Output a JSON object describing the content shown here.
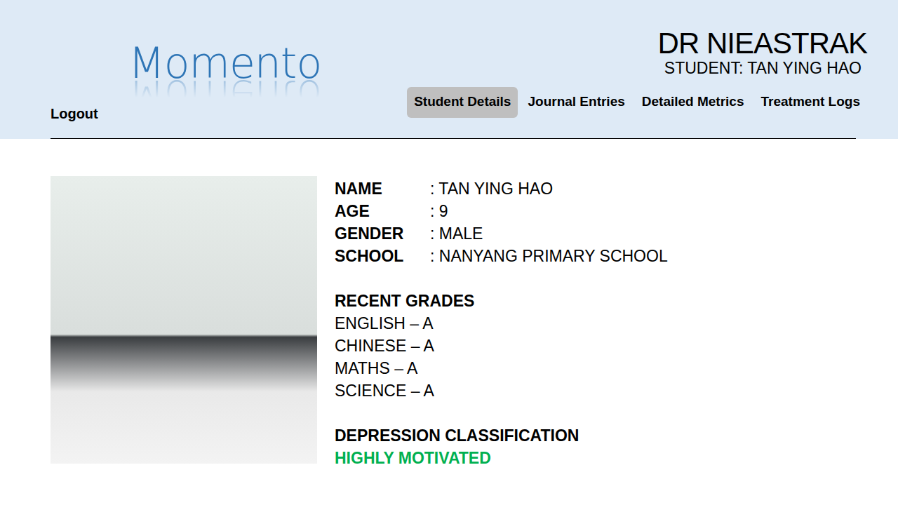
{
  "app": {
    "logo": "Momento",
    "logout": "Logout"
  },
  "header": {
    "doctor": "DR NIEASTRAK",
    "student": "STUDENT: TAN YING HAO"
  },
  "tabs": [
    {
      "label": "Student Details",
      "selected": true
    },
    {
      "label": "Journal Entries",
      "selected": false
    },
    {
      "label": "Detailed Metrics",
      "selected": false
    },
    {
      "label": "Treatment Logs",
      "selected": false
    }
  ],
  "details": [
    {
      "label": "NAME",
      "value": ": TAN YING HAO"
    },
    {
      "label": "AGE",
      "value": ": 9"
    },
    {
      "label": "GENDER",
      "value": ": MALE"
    },
    {
      "label": "SCHOOL",
      "value": ": NANYANG PRIMARY SCHOOL"
    }
  ],
  "grades": {
    "title": "RECENT GRADES",
    "items": [
      "ENGLISH – A",
      "CHINESE – A",
      "MATHS – A",
      "SCIENCE – A"
    ]
  },
  "classification": {
    "title": "DEPRESSION CLASSIFICATION",
    "value": "HIGHLY MOTIVATED"
  }
}
